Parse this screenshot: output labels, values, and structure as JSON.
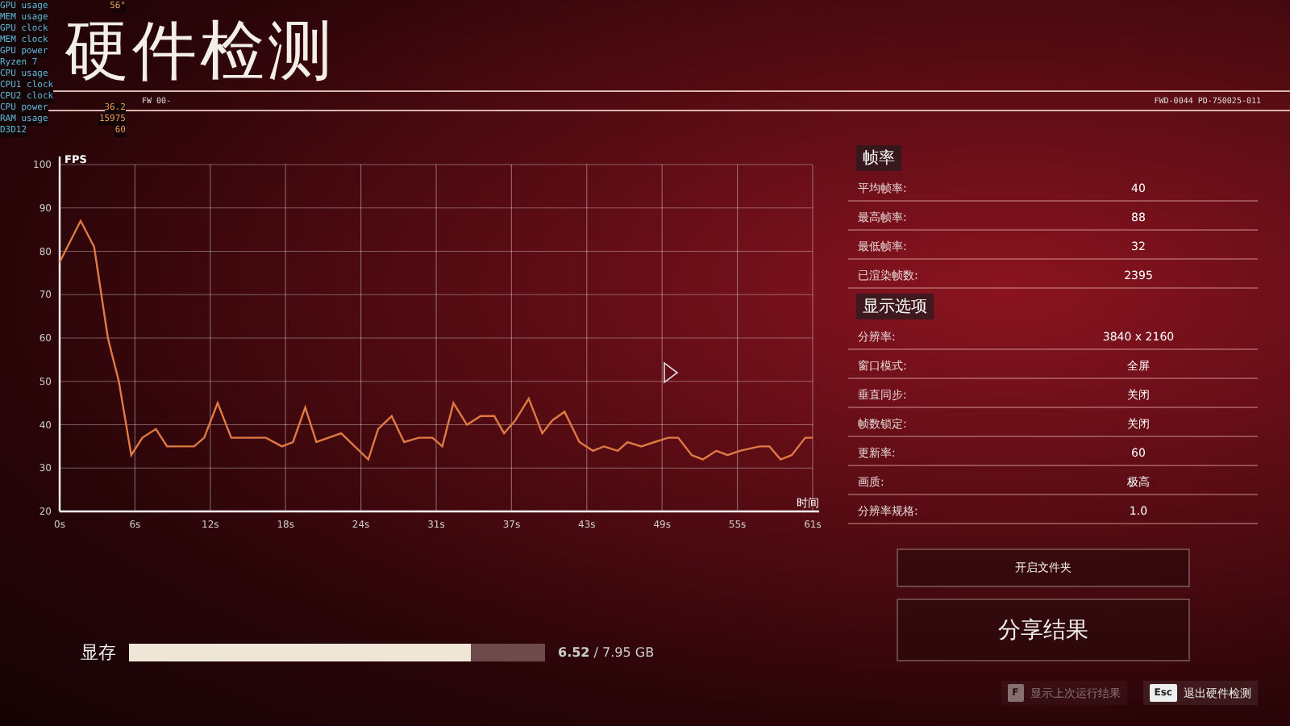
{
  "title": "硬件检测",
  "header_codes": [
    "FW 00-",
    "FWD-0044 PD-750025-011"
  ],
  "osd": [
    {
      "label": "GPU usage",
      "value": "56°"
    },
    {
      "label": "MEM usage"
    },
    {
      "label": "GPU clock"
    },
    {
      "label": "MEM clock"
    },
    {
      "label": "GPU power"
    },
    {
      "label": "Ryzen 7"
    },
    {
      "label": "CPU usage"
    },
    {
      "label": "CPU1 clock"
    },
    {
      "label": "CPU2 clock"
    },
    {
      "label": "CPU power",
      "value": "36.2"
    },
    {
      "label": "RAM usage",
      "value": "15975"
    },
    {
      "label": "D3D12",
      "value": "60"
    }
  ],
  "chart": {
    "chart_data": {
      "type": "line",
      "grid": true,
      "xlabel": "时间",
      "ylabel": "FPS",
      "ylim": [
        20,
        100
      ],
      "xlim": [
        0,
        61
      ],
      "yticks": [
        20,
        30,
        40,
        50,
        60,
        70,
        80,
        90,
        100
      ],
      "xticks": [
        {
          "value": 0,
          "label": "0s"
        },
        {
          "value": 6.1,
          "label": "6s"
        },
        {
          "value": 12.2,
          "label": "12s"
        },
        {
          "value": 18.3,
          "label": "18s"
        },
        {
          "value": 24.4,
          "label": "24s"
        },
        {
          "value": 30.5,
          "label": "31s"
        },
        {
          "value": 36.6,
          "label": "37s"
        },
        {
          "value": 42.7,
          "label": "43s"
        },
        {
          "value": 48.8,
          "label": "49s"
        },
        {
          "value": 54.9,
          "label": "55s"
        },
        {
          "value": 61,
          "label": "61s"
        }
      ],
      "x": [
        0,
        1.7,
        2.8,
        3.9,
        4.8,
        5.8,
        6.7,
        7.8,
        8.7,
        10.9,
        11.7,
        12.8,
        13.9,
        16.7,
        18.0,
        18.9,
        19.9,
        20.8,
        22.8,
        25.0,
        25.8,
        26.9,
        27.9,
        29.1,
        30.2,
        31.0,
        31.9,
        33.0,
        34.1,
        35.2,
        36.0,
        36.9,
        38.0,
        39.1,
        39.9,
        40.9,
        42.1,
        43.2,
        44.1,
        45.2,
        46.0,
        47.1,
        48.2,
        49.3,
        50.1,
        51.2,
        52.1,
        53.2,
        54.1,
        55.1,
        56.7,
        57.5,
        58.4,
        59.3,
        60.4,
        61
      ],
      "series": [
        {
          "color": "#e07a45",
          "values": [
            77.5,
            87,
            81,
            60,
            50,
            33,
            37,
            39,
            35,
            35,
            37,
            45,
            37,
            37,
            35,
            36,
            44,
            36,
            38,
            32,
            39,
            42,
            36,
            37,
            37,
            35,
            45,
            40,
            42,
            42,
            38,
            41,
            46,
            38,
            41,
            43,
            36,
            34,
            35,
            34,
            36,
            35,
            36,
            37,
            37,
            33,
            32,
            34,
            33,
            34,
            35,
            35,
            32,
            33,
            37,
            37
          ]
        }
      ]
    }
  },
  "sections": [
    {
      "heading": "帧率",
      "rows": [
        {
          "label": "平均帧率:",
          "value": "40"
        },
        {
          "label": "最高帧率:",
          "value": "88"
        },
        {
          "label": "最低帧率:",
          "value": "32"
        },
        {
          "label": "已渲染帧数:",
          "value": "2395"
        }
      ]
    },
    {
      "heading": "显示选项",
      "rows": [
        {
          "label": "分辨率:",
          "value": "3840 x 2160"
        },
        {
          "label": "窗口模式:",
          "value": "全屏"
        },
        {
          "label": "垂直同步:",
          "value": "关闭"
        },
        {
          "label": "帧数锁定:",
          "value": "关闭"
        },
        {
          "label": "更新率:",
          "value": "60"
        },
        {
          "label": "画质:",
          "value": "极高"
        },
        {
          "label": "分辨率规格:",
          "value": "1.0"
        }
      ]
    }
  ],
  "buttons": [
    {
      "label": "开启文件夹",
      "kind": "small"
    },
    {
      "label": "分享结果",
      "kind": "large"
    }
  ],
  "vram": {
    "label": "显存",
    "level": 0.82,
    "used": "6.52",
    "total": "/ 7.95 GB"
  },
  "hints": [
    {
      "key": "F",
      "label": "显示上次运行结果",
      "disabled": true
    },
    {
      "key": "Esc",
      "label": "退出硬件检测",
      "disabled": false
    }
  ]
}
